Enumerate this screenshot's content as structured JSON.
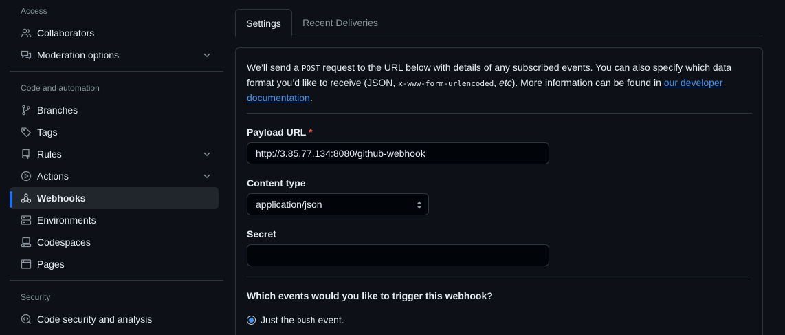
{
  "sidebar": {
    "sections": {
      "access": "Access",
      "code_automation": "Code and automation",
      "security": "Security"
    },
    "items": [
      {
        "label": "Collaborators",
        "icon": "people-icon"
      },
      {
        "label": "Moderation options",
        "icon": "comment-discussion-icon"
      },
      {
        "label": "Branches",
        "icon": "git-branch-icon"
      },
      {
        "label": "Tags",
        "icon": "tag-icon"
      },
      {
        "label": "Rules",
        "icon": "repo-push-icon"
      },
      {
        "label": "Actions",
        "icon": "play-icon"
      },
      {
        "label": "Webhooks",
        "icon": "webhook-icon",
        "active": true
      },
      {
        "label": "Environments",
        "icon": "server-icon"
      },
      {
        "label": "Codespaces",
        "icon": "codespaces-icon"
      },
      {
        "label": "Pages",
        "icon": "browser-icon"
      },
      {
        "label": "Code security and analysis",
        "icon": "codescan-icon"
      }
    ]
  },
  "tabs": [
    {
      "label": "Settings",
      "active": true
    },
    {
      "label": "Recent Deliveries",
      "active": false
    }
  ],
  "intro": {
    "p1": "We’ll send a ",
    "post": "POST",
    "p2": " request to the URL below with details of any subscribed events. You can also specify which data format you’d like to receive (JSON, ",
    "urlencoded": "x-www-form-urlencoded",
    "p3": ", ",
    "etc": "etc",
    "p4": "). More information can be found in ",
    "link": "our developer documentation",
    "p5": "."
  },
  "form": {
    "payload_label": "Payload URL",
    "required_mark": "*",
    "payload_value": "http://3.85.77.134:8080/github-webhook",
    "content_type_label": "Content type",
    "content_type_value": "application/json",
    "secret_label": "Secret",
    "secret_value": "",
    "events_question": "Which events would you like to trigger this webhook?",
    "radio_just_push_a": "Just the",
    "radio_just_push_code": "push",
    "radio_just_push_b": "event."
  },
  "colors": {
    "background": "#0d1117",
    "accent": "#1f6feb",
    "link": "#4493f8",
    "required": "#f85149"
  }
}
